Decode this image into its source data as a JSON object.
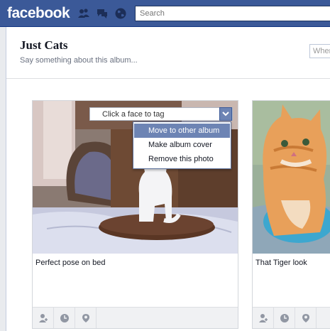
{
  "header": {
    "logo": "facebook",
    "search_placeholder": "Search"
  },
  "album": {
    "title": "Just Cats",
    "description_placeholder": "Say something about this album...",
    "where_placeholder": "Where"
  },
  "photos": [
    {
      "caption": "Perfect pose on bed",
      "tag_prompt": "Click a face to tag",
      "menu": [
        "Move to other album",
        "Make album cover",
        "Remove this photo"
      ]
    },
    {
      "caption": "That Tiger look"
    }
  ],
  "colors": {
    "brand_blue": "#3b5998",
    "menu_highlight": "#6d84b4",
    "page_bg": "#e9ebee"
  }
}
